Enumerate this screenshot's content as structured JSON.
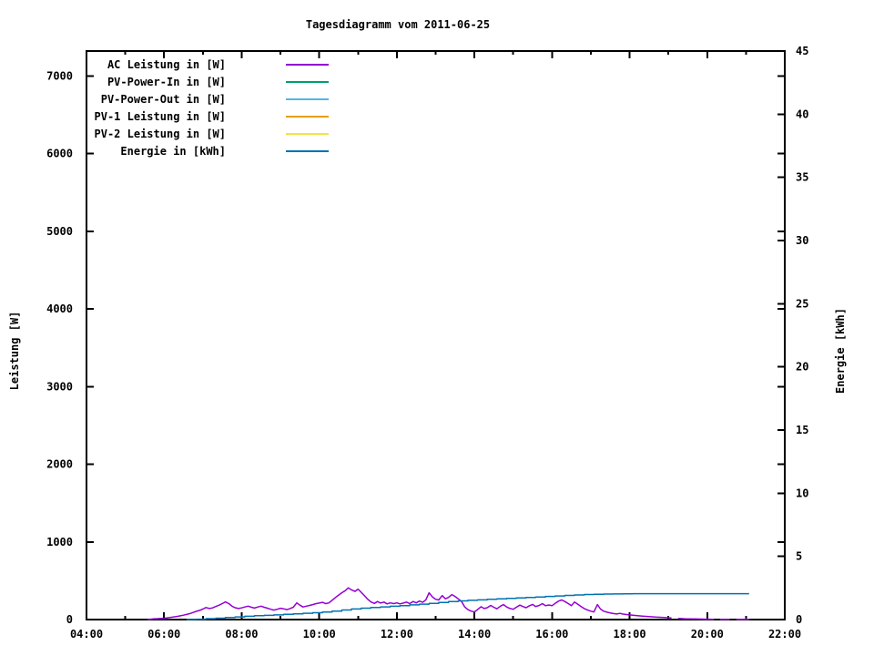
{
  "window": {
    "background": "#ffffff",
    "text_color": "#000000"
  },
  "chart_data": {
    "type": "line",
    "title": "Tagesdiagramm vom 2011-06-25",
    "y1label": "Leistung [W]",
    "y2label": "Energie [kWh]",
    "xlabel": "",
    "grid": false,
    "legend_position": "top-left-inside",
    "x_axis": {
      "min": 4,
      "max": 22,
      "major_step": 2,
      "minor_step": 1,
      "tick_labels": [
        "04:00",
        "06:00",
        "08:00",
        "10:00",
        "12:00",
        "14:00",
        "16:00",
        "18:00",
        "20:00",
        "22:00"
      ],
      "tick_values": [
        4,
        6,
        8,
        10,
        12,
        14,
        16,
        18,
        20,
        22
      ]
    },
    "y1_axis": {
      "min": 0,
      "max": 7320,
      "tick_step": 1000,
      "tick_labels": [
        "0",
        "1000",
        "2000",
        "3000",
        "4000",
        "5000",
        "6000",
        "7000"
      ],
      "tick_values": [
        0,
        1000,
        2000,
        3000,
        4000,
        5000,
        6000,
        7000
      ]
    },
    "y2_axis": {
      "min": 0,
      "max": 45,
      "tick_step": 5,
      "tick_labels": [
        "0",
        "5",
        "10",
        "15",
        "20",
        "25",
        "30",
        "35",
        "40",
        "45"
      ],
      "tick_values": [
        0,
        5,
        10,
        15,
        20,
        25,
        30,
        35,
        40,
        45
      ]
    },
    "series": [
      {
        "name": "AC Leistung in [W]",
        "color": "#9400d3",
        "axis": "y1",
        "style": "line",
        "points": [
          [
            5.58,
            2
          ],
          [
            5.67,
            6
          ],
          [
            5.75,
            10
          ],
          [
            5.83,
            12
          ],
          [
            5.92,
            15
          ],
          [
            6.0,
            18
          ],
          [
            6.08,
            22
          ],
          [
            6.17,
            28
          ],
          [
            6.25,
            34
          ],
          [
            6.33,
            40
          ],
          [
            6.42,
            48
          ],
          [
            6.5,
            56
          ],
          [
            6.58,
            66
          ],
          [
            6.67,
            78
          ],
          [
            6.75,
            92
          ],
          [
            6.83,
            105
          ],
          [
            6.92,
            118
          ],
          [
            7.0,
            135
          ],
          [
            7.08,
            155
          ],
          [
            7.17,
            142
          ],
          [
            7.25,
            150
          ],
          [
            7.33,
            168
          ],
          [
            7.42,
            185
          ],
          [
            7.5,
            205
          ],
          [
            7.58,
            228
          ],
          [
            7.67,
            205
          ],
          [
            7.75,
            172
          ],
          [
            7.83,
            152
          ],
          [
            7.92,
            142
          ],
          [
            8.0,
            150
          ],
          [
            8.08,
            162
          ],
          [
            8.17,
            172
          ],
          [
            8.25,
            158
          ],
          [
            8.33,
            148
          ],
          [
            8.42,
            162
          ],
          [
            8.5,
            172
          ],
          [
            8.58,
            158
          ],
          [
            8.67,
            146
          ],
          [
            8.75,
            132
          ],
          [
            8.83,
            122
          ],
          [
            8.92,
            132
          ],
          [
            9.0,
            145
          ],
          [
            9.08,
            138
          ],
          [
            9.17,
            128
          ],
          [
            9.25,
            142
          ],
          [
            9.33,
            158
          ],
          [
            9.42,
            215
          ],
          [
            9.5,
            185
          ],
          [
            9.58,
            162
          ],
          [
            9.67,
            172
          ],
          [
            9.75,
            182
          ],
          [
            9.83,
            192
          ],
          [
            9.92,
            205
          ],
          [
            10.0,
            212
          ],
          [
            10.08,
            222
          ],
          [
            10.17,
            205
          ],
          [
            10.25,
            215
          ],
          [
            10.33,
            248
          ],
          [
            10.42,
            285
          ],
          [
            10.5,
            315
          ],
          [
            10.58,
            345
          ],
          [
            10.67,
            372
          ],
          [
            10.75,
            408
          ],
          [
            10.83,
            382
          ],
          [
            10.92,
            362
          ],
          [
            11.0,
            392
          ],
          [
            11.08,
            352
          ],
          [
            11.17,
            305
          ],
          [
            11.25,
            262
          ],
          [
            11.33,
            228
          ],
          [
            11.42,
            208
          ],
          [
            11.5,
            232
          ],
          [
            11.58,
            212
          ],
          [
            11.67,
            225
          ],
          [
            11.75,
            202
          ],
          [
            11.83,
            215
          ],
          [
            11.92,
            205
          ],
          [
            12.0,
            215
          ],
          [
            12.08,
            202
          ],
          [
            12.17,
            212
          ],
          [
            12.25,
            225
          ],
          [
            12.33,
            205
          ],
          [
            12.42,
            232
          ],
          [
            12.5,
            215
          ],
          [
            12.58,
            238
          ],
          [
            12.67,
            222
          ],
          [
            12.75,
            255
          ],
          [
            12.83,
            345
          ],
          [
            12.92,
            290
          ],
          [
            13.0,
            262
          ],
          [
            13.08,
            252
          ],
          [
            13.17,
            308
          ],
          [
            13.25,
            268
          ],
          [
            13.33,
            285
          ],
          [
            13.42,
            322
          ],
          [
            13.5,
            298
          ],
          [
            13.58,
            268
          ],
          [
            13.67,
            232
          ],
          [
            13.75,
            162
          ],
          [
            13.83,
            128
          ],
          [
            13.92,
            108
          ],
          [
            14.0,
            98
          ],
          [
            14.08,
            128
          ],
          [
            14.17,
            165
          ],
          [
            14.25,
            142
          ],
          [
            14.33,
            152
          ],
          [
            14.42,
            182
          ],
          [
            14.5,
            158
          ],
          [
            14.58,
            138
          ],
          [
            14.67,
            172
          ],
          [
            14.75,
            192
          ],
          [
            14.83,
            162
          ],
          [
            14.92,
            142
          ],
          [
            15.0,
            132
          ],
          [
            15.08,
            158
          ],
          [
            15.17,
            185
          ],
          [
            15.25,
            168
          ],
          [
            15.33,
            152
          ],
          [
            15.42,
            178
          ],
          [
            15.5,
            195
          ],
          [
            15.58,
            168
          ],
          [
            15.67,
            182
          ],
          [
            15.75,
            205
          ],
          [
            15.83,
            178
          ],
          [
            15.92,
            188
          ],
          [
            16.0,
            178
          ],
          [
            16.08,
            208
          ],
          [
            16.17,
            238
          ],
          [
            16.25,
            252
          ],
          [
            16.33,
            232
          ],
          [
            16.42,
            205
          ],
          [
            16.5,
            178
          ],
          [
            16.58,
            225
          ],
          [
            16.67,
            195
          ],
          [
            16.75,
            168
          ],
          [
            16.83,
            142
          ],
          [
            16.92,
            122
          ],
          [
            17.0,
            108
          ],
          [
            17.08,
            98
          ],
          [
            17.17,
            192
          ],
          [
            17.25,
            135
          ],
          [
            17.33,
            108
          ],
          [
            17.42,
            95
          ],
          [
            17.5,
            85
          ],
          [
            17.58,
            78
          ],
          [
            17.67,
            72
          ],
          [
            17.75,
            80
          ],
          [
            17.83,
            70
          ],
          [
            17.92,
            65
          ],
          [
            18.0,
            60
          ],
          [
            18.17,
            52
          ],
          [
            18.33,
            45
          ],
          [
            18.5,
            38
          ],
          [
            18.67,
            32
          ],
          [
            18.83,
            28
          ],
          [
            19.0,
            24
          ],
          [
            19.08,
            20
          ],
          null,
          [
            19.25,
            14
          ],
          [
            19.42,
            11
          ],
          [
            19.58,
            9
          ],
          [
            19.75,
            7
          ],
          [
            20.0,
            5
          ],
          [
            20.17,
            4
          ],
          null,
          [
            20.33,
            3
          ],
          [
            20.58,
            3
          ],
          null,
          [
            20.75,
            2
          ],
          [
            21.08,
            2
          ]
        ]
      },
      {
        "name": "PV-Power-In in [W]",
        "color": "#009e73",
        "axis": "y1",
        "style": "line",
        "points": []
      },
      {
        "name": "PV-Power-Out in [W]",
        "color": "#56b4e9",
        "axis": "y1",
        "style": "line",
        "points": []
      },
      {
        "name": "PV-1 Leistung in [W]",
        "color": "#e69f00",
        "axis": "y1",
        "style": "line",
        "points": []
      },
      {
        "name": "PV-2 Leistung in [W]",
        "color": "#f0e442",
        "axis": "y1",
        "style": "line",
        "points": []
      },
      {
        "name": "Energie in [kWh]",
        "color": "#0072b2",
        "axis": "y2",
        "style": "steps",
        "points": [
          [
            6.58,
            0.01
          ],
          [
            6.83,
            0.03
          ],
          [
            7.08,
            0.07
          ],
          [
            7.33,
            0.11
          ],
          [
            7.58,
            0.16
          ],
          [
            7.83,
            0.21
          ],
          [
            8.08,
            0.26
          ],
          [
            8.33,
            0.3
          ],
          [
            8.58,
            0.33
          ],
          [
            8.83,
            0.37
          ],
          [
            9.08,
            0.41
          ],
          [
            9.33,
            0.45
          ],
          [
            9.58,
            0.5
          ],
          [
            9.83,
            0.54
          ],
          [
            10.08,
            0.6
          ],
          [
            10.33,
            0.67
          ],
          [
            10.58,
            0.76
          ],
          [
            10.83,
            0.84
          ],
          [
            11.08,
            0.9
          ],
          [
            11.33,
            0.95
          ],
          [
            11.58,
            1.0
          ],
          [
            11.83,
            1.05
          ],
          [
            12.08,
            1.1
          ],
          [
            12.33,
            1.16
          ],
          [
            12.58,
            1.22
          ],
          [
            12.83,
            1.28
          ],
          [
            13.08,
            1.35
          ],
          [
            13.33,
            1.42
          ],
          [
            13.58,
            1.48
          ],
          [
            13.83,
            1.52
          ],
          [
            14.08,
            1.56
          ],
          [
            14.33,
            1.6
          ],
          [
            14.58,
            1.64
          ],
          [
            14.83,
            1.68
          ],
          [
            15.08,
            1.71
          ],
          [
            15.33,
            1.75
          ],
          [
            15.58,
            1.79
          ],
          [
            15.83,
            1.83
          ],
          [
            16.08,
            1.87
          ],
          [
            16.33,
            1.91
          ],
          [
            16.58,
            1.95
          ],
          [
            16.83,
            1.98
          ],
          [
            17.08,
            2.0
          ],
          [
            17.33,
            2.02
          ],
          [
            17.58,
            2.03
          ],
          [
            17.83,
            2.04
          ],
          [
            18.08,
            2.05
          ],
          [
            18.58,
            2.05
          ],
          [
            21.08,
            2.05
          ]
        ]
      }
    ]
  }
}
